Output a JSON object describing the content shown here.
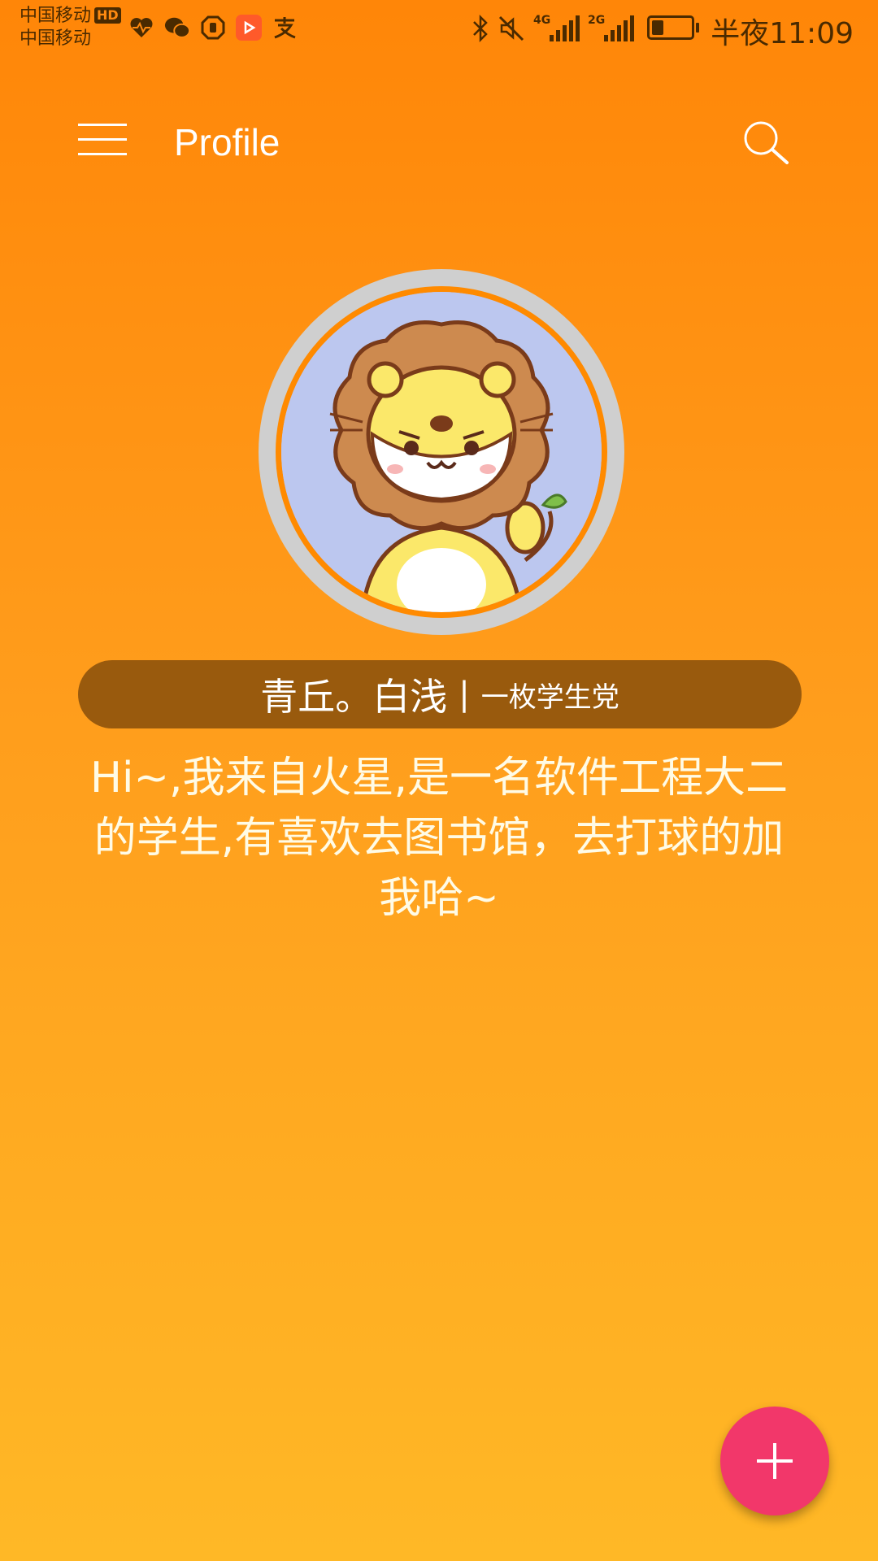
{
  "status_bar": {
    "carrier_line1": "中国移动",
    "carrier_line2": "中国移动",
    "hd_badge": "HD",
    "network_4g": "4G",
    "network_2g": "2G",
    "time": "半夜11:09",
    "battery_percent": 30,
    "notification_icons": [
      "heart-rate-icon",
      "wechat-icon",
      "shield-icon",
      "video-app-icon",
      "alipay-icon"
    ],
    "system_icons": [
      "bluetooth-icon",
      "mute-icon",
      "signal-icon",
      "battery-icon"
    ]
  },
  "toolbar": {
    "title": "Profile",
    "menu_icon": "menu-icon",
    "search_icon": "search-icon"
  },
  "profile": {
    "name": "青丘。白浅",
    "separator": "|",
    "tagline": "一枚学生党",
    "bio": "Hi~,我来自火星,是一名软件工程大二的学生,有喜欢去图书馆，去打球的加我哈~"
  },
  "fab": {
    "icon": "plus-icon"
  },
  "colors": {
    "gradient_top": "#ff8608",
    "gradient_bottom": "#ffb826",
    "name_pill": "#995a0d",
    "fab": "#f2376a"
  }
}
